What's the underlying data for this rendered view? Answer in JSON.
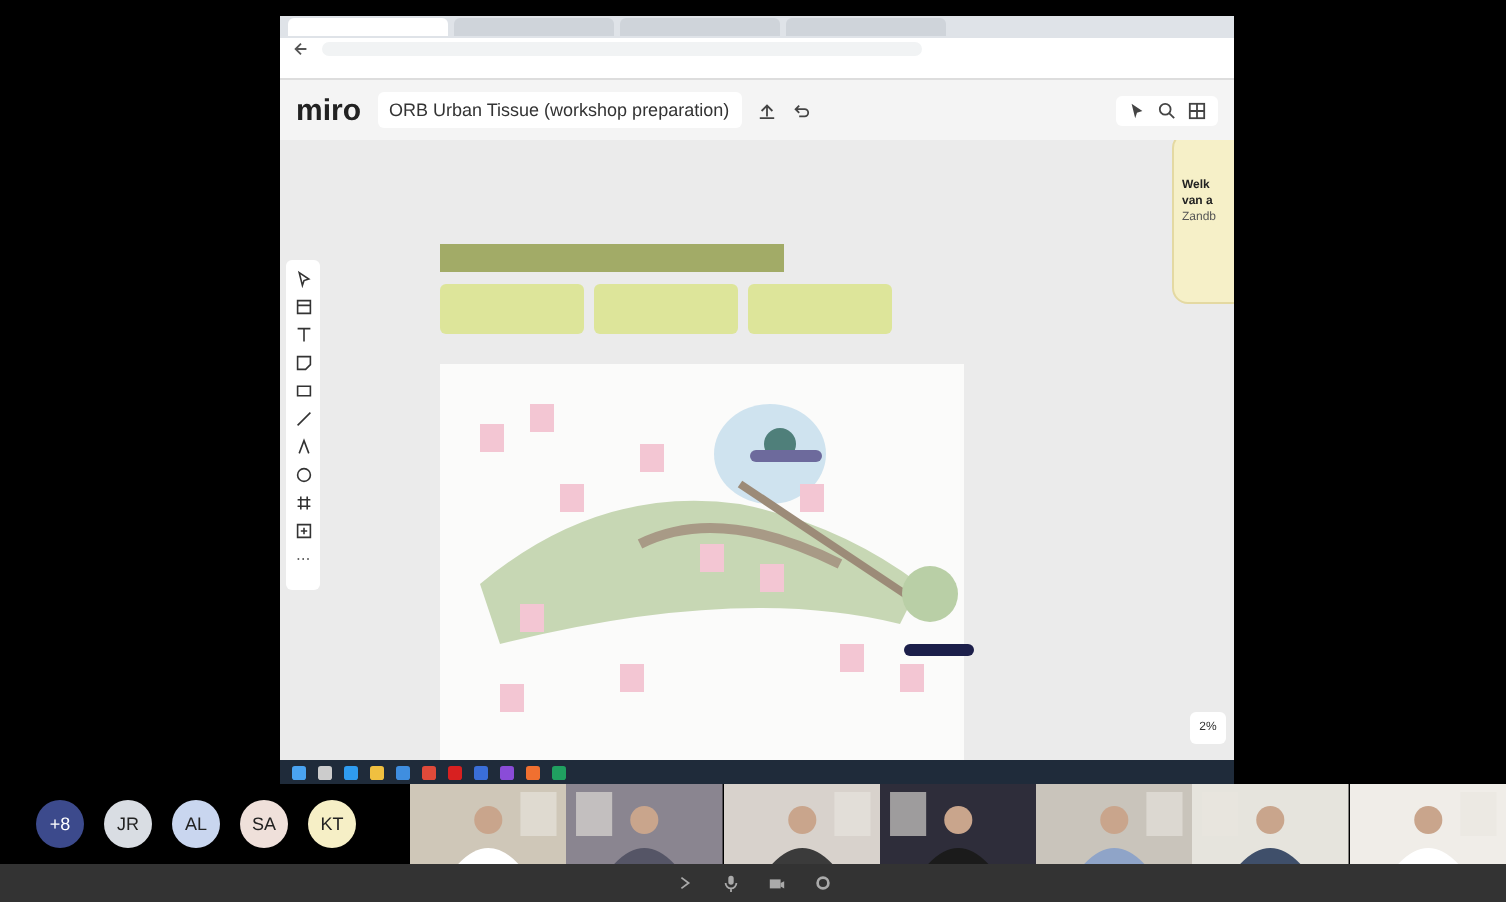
{
  "browser": {
    "tabs": [
      {
        "selected": true
      },
      {
        "selected": false
      },
      {
        "selected": false
      },
      {
        "selected": false
      }
    ]
  },
  "miro": {
    "logo": "miro",
    "board_title": "ORB Urban Tissue (workshop preparation)",
    "side_card": [
      "Welk",
      "van a",
      "Zandb"
    ],
    "zoom": "2%"
  },
  "participants": [
    {
      "initials": "+8",
      "color": "#3c4a8c"
    },
    {
      "initials": "JR",
      "color": "#d9dde3"
    },
    {
      "initials": "AL",
      "color": "#c9d6ef"
    },
    {
      "initials": "SA",
      "color": "#efe0da"
    },
    {
      "initials": "KT",
      "color": "#f6efc6"
    }
  ]
}
